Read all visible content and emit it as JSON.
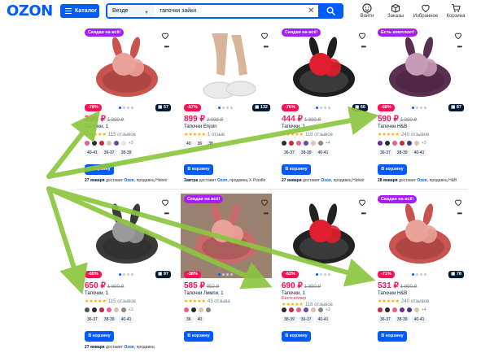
{
  "header": {
    "logo": "OZON",
    "catalog_label": "Каталог",
    "search_scope": "Везде",
    "search_query": "тапочки зайки",
    "icons": [
      {
        "name": "login",
        "label": "Войти",
        "icon": "user-icon"
      },
      {
        "name": "orders",
        "label": "Заказы",
        "icon": "box-icon"
      },
      {
        "name": "favorites",
        "label": "Избранное",
        "icon": "heart-icon"
      },
      {
        "name": "cart",
        "label": "Корзина",
        "icon": "cart-icon"
      }
    ]
  },
  "products": [
    {
      "tag": "Скидки на всё!",
      "discount": "-78%",
      "video_count": "57",
      "price": "399 ₽",
      "old_price": "1 890 ₽",
      "title": "Тапочки, 1",
      "extra": "",
      "rating_stars": "★★★★★",
      "reviews": "115 отзывов",
      "swatches": [
        "#e85d8c",
        "#2a2a2a",
        "#c8283c",
        "#d8c4b0",
        "#6b4a9b",
        "#e6e6e6"
      ],
      "more": "+3",
      "sizes": [
        "40-41",
        "36-37",
        "38-39"
      ],
      "cart_label": "В корзину",
      "delivery_date": "27 января",
      "delivery_text": "доставит",
      "seller_brand": "Ozon",
      "delivery_tail": ", продавец Hidoor",
      "product_color": "#c9534f"
    },
    {
      "tag": "",
      "discount": "-57%",
      "video_count": "132",
      "price": "899 ₽",
      "old_price": "2 099 ₽",
      "title": "Тапочки Enjoin",
      "extra": "",
      "rating_stars": "★★★★★",
      "reviews": "1 отзыв",
      "swatches": [],
      "more": "",
      "sizes": [
        "40",
        "36",
        "38"
      ],
      "cart_label": "В корзину",
      "delivery_date": "Завтра",
      "delivery_text": "доставит",
      "seller_brand": "Ozon",
      "delivery_tail": ", продавец X-Poodle",
      "product_color": "#e9e9e9"
    },
    {
      "tag": "Скидки на всё!",
      "discount": "-76%",
      "video_count": "66",
      "price": "444 ₽",
      "old_price": "1 890 ₽",
      "title": "Тапочки, 1",
      "extra": "",
      "rating_stars": "★★★★★",
      "reviews": "118 отзывов",
      "swatches": [
        "#2a2a2a",
        "#c8283c",
        "#e85d8c",
        "#6b4a9b",
        "#d8c4b0",
        "#888888"
      ],
      "more": "+4",
      "sizes": [
        "36-37",
        "38-39",
        "40-41"
      ],
      "cart_label": "В корзину",
      "delivery_date": "27 января",
      "delivery_text": "доставит",
      "seller_brand": "Ozon",
      "delivery_tail": ", продавец Hidoor",
      "product_color": "#1e1e1e"
    },
    {
      "tag": "Есть комплект!",
      "discount": "-68%",
      "video_count": "87",
      "price": "590 ₽",
      "old_price": "1 890 ₽",
      "title": "Тапочки H&B",
      "extra": "",
      "rating_stars": "★★★★★",
      "reviews": "240 отзывов",
      "swatches": [
        "#6b2aa0",
        "#2a2a2a",
        "#e85d8c",
        "#c8283c",
        "#3a3a8a",
        "#d8c4b0"
      ],
      "more": "+3",
      "sizes": [
        "36-37",
        "38-39",
        "40-41"
      ],
      "cart_label": "В корзину",
      "delivery_date": "28 января",
      "delivery_text": "доставит",
      "seller_brand": "Ozon",
      "delivery_tail": ", продавец H&B",
      "product_color": "#5a2f4f"
    },
    {
      "tag": "",
      "discount": "-65%",
      "video_count": "97",
      "price": "650 ₽",
      "old_price": "1 890 ₽",
      "title": "Тапочки, 1",
      "extra": "",
      "rating_stars": "★★★★★",
      "reviews": "115 отзывов",
      "swatches": [
        "#555555",
        "#2a2a2a",
        "#c8283c",
        "#e85d8c",
        "#d8c4b0",
        "#888888"
      ],
      "more": "+3",
      "sizes": [
        "36-37",
        "38-39",
        "40-41"
      ],
      "cart_label": "В корзину",
      "delivery_date": "27 января",
      "delivery_text": "доставит",
      "seller_brand": "Ozon",
      "delivery_tail": ", продавец",
      "product_color": "#3a3a3a"
    },
    {
      "tag": "Скидки на всё!",
      "discount": "-38%",
      "video_count": "",
      "price": "585 ₽",
      "old_price": "950 ₽",
      "title": "Тапочки Лимпи, 1",
      "extra": "",
      "rating_stars": "★★★★★",
      "reviews": "43 отзыва",
      "swatches": [
        "#e85d8c",
        "#2a2a2a",
        "#d8c4b0",
        "#888888"
      ],
      "more": "",
      "sizes": [
        "36",
        "40"
      ],
      "cart_label": "В корзину",
      "delivery_date": "",
      "delivery_text": "",
      "seller_brand": "",
      "delivery_tail": "",
      "product_color": "#c86a6a"
    },
    {
      "tag": "",
      "discount": "-63%",
      "video_count": "",
      "price": "690 ₽",
      "old_price": "1 890 ₽",
      "title": "Тапочки, 1",
      "extra": "Бестселлер",
      "rating_stars": "★★★★★",
      "reviews": "118 отзывов",
      "swatches": [
        "#2a2a2a",
        "#c8283c",
        "#e85d8c",
        "#6b4a9b",
        "#d8c4b0",
        "#888888"
      ],
      "more": "+3",
      "sizes": [
        "38-39",
        "36-37",
        "40-41"
      ],
      "cart_label": "В корзину",
      "delivery_date": "",
      "delivery_text": "",
      "seller_brand": "",
      "delivery_tail": "",
      "product_color": "#222222"
    },
    {
      "tag": "Скидки на всё!",
      "discount": "-71%",
      "video_count": "78",
      "price": "531 ₽",
      "old_price": "1 890 ₽",
      "title": "Тапочки H&B",
      "extra": "",
      "rating_stars": "★★★★★",
      "reviews": "240 отзывов",
      "swatches": [
        "#c8283c",
        "#2a2a2a",
        "#e85d8c",
        "#6b2aa0",
        "#3a3a8a",
        "#d8c4b0"
      ],
      "more": "+4",
      "sizes": [
        "36-37",
        "38-39",
        "40-41"
      ],
      "cart_label": "В корзину",
      "delivery_date": "",
      "delivery_text": "",
      "seller_brand": "",
      "delivery_tail": "",
      "product_color": "#c9534f"
    }
  ],
  "colors": {
    "brand_blue": "#005bff",
    "price_red": "#f91155",
    "tag_purple": "#a61bff",
    "arrow_green": "#8cc63f"
  }
}
